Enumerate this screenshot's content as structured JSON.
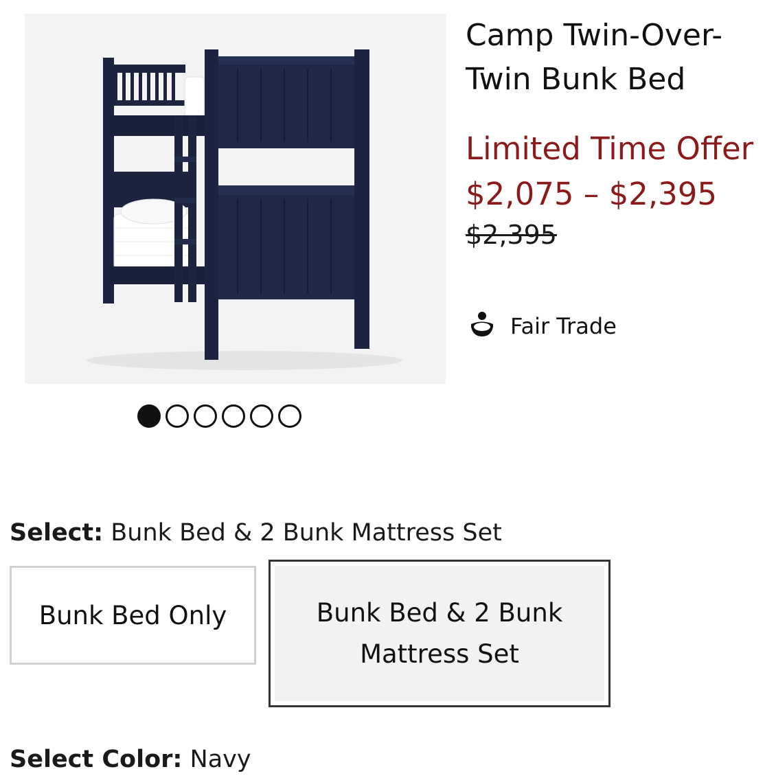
{
  "product": {
    "title": "Camp Twin-Over-Twin Bunk Bed",
    "offer_label": "Limited Time Offer",
    "price_range": "$2,075 – $2,395",
    "original_price": "$2,395",
    "badge": {
      "icon": "fair-trade-icon",
      "label": "Fair Trade"
    }
  },
  "gallery": {
    "image": "navy-bunk-bed-photo",
    "dots": [
      {
        "active": true
      },
      {
        "active": false
      },
      {
        "active": false
      },
      {
        "active": false
      },
      {
        "active": false
      },
      {
        "active": false
      }
    ]
  },
  "configuration": {
    "label": "Select:",
    "value": "Bunk Bed & 2 Bunk Mattress Set",
    "options": [
      {
        "label": "Bunk Bed Only",
        "selected": false
      },
      {
        "label": "Bunk Bed & 2 Bunk Mattress Set",
        "selected": true
      }
    ]
  },
  "color": {
    "label": "Select Color:",
    "value": "Navy"
  },
  "colors": {
    "price": "#8b1a1a",
    "bed": "#1c2440",
    "image_bg": "#f3f3f3"
  }
}
